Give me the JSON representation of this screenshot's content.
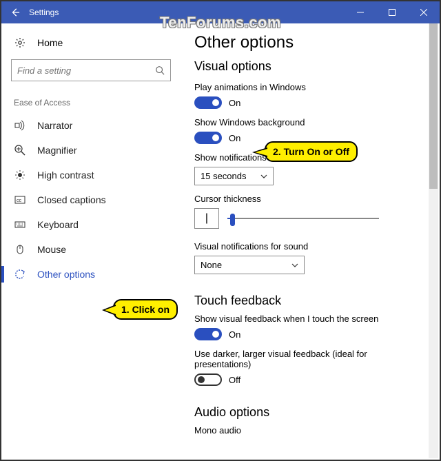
{
  "window": {
    "title": "Settings"
  },
  "watermark": "TenForums.com",
  "sidebar": {
    "home": "Home",
    "search_placeholder": "Find a setting",
    "section": "Ease of Access",
    "items": [
      {
        "label": "Narrator"
      },
      {
        "label": "Magnifier"
      },
      {
        "label": "High contrast"
      },
      {
        "label": "Closed captions"
      },
      {
        "label": "Keyboard"
      },
      {
        "label": "Mouse"
      },
      {
        "label": "Other options"
      }
    ]
  },
  "main": {
    "heading": "Other options",
    "visual_heading": "Visual options",
    "play_anim_label": "Play animations in Windows",
    "play_anim_state": "On",
    "show_bg_label": "Show Windows background",
    "show_bg_state": "On",
    "notif_label": "Show notifications for",
    "notif_value": "15 seconds",
    "cursor_label": "Cursor thickness",
    "visual_notif_label": "Visual notifications for sound",
    "visual_notif_value": "None",
    "touch_heading": "Touch feedback",
    "touch_label": "Show visual feedback when I touch the screen",
    "touch_state": "On",
    "darker_label": "Use darker, larger visual feedback (ideal for presentations)",
    "darker_state": "Off",
    "audio_heading": "Audio options",
    "mono_label": "Mono audio"
  },
  "callouts": {
    "c1": "1. Click on",
    "c2": "2. Turn On or Off"
  }
}
